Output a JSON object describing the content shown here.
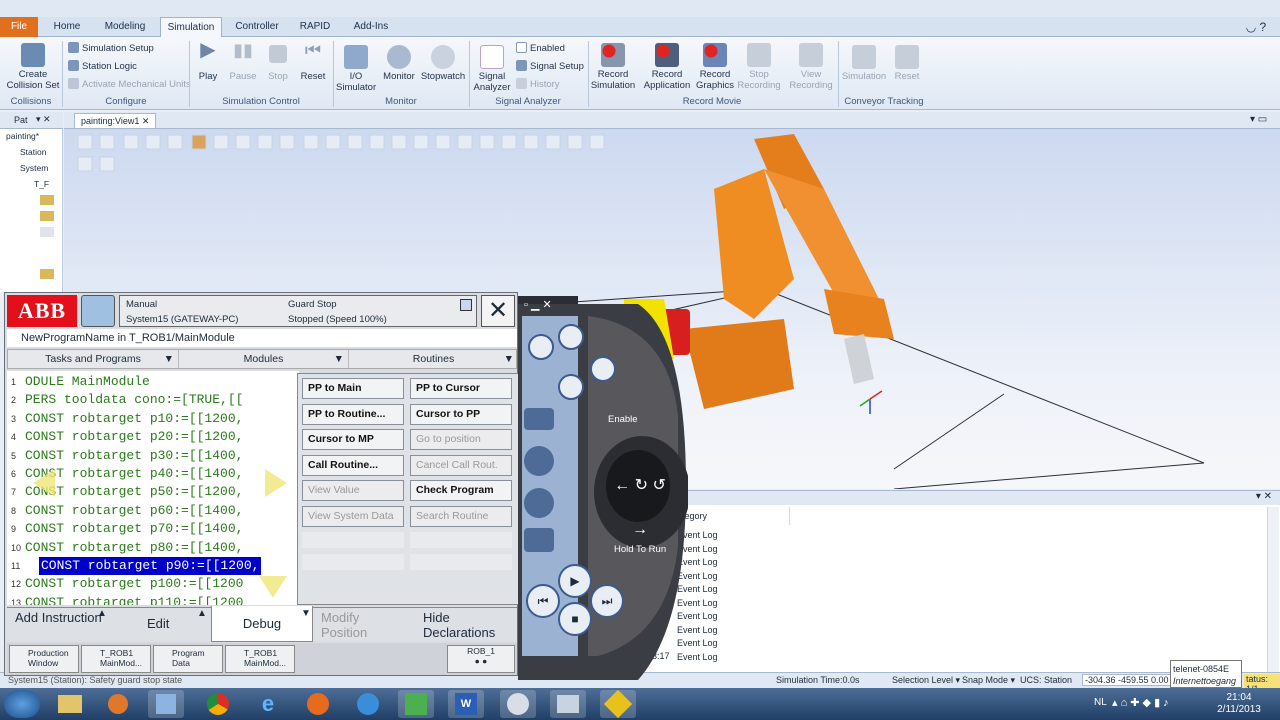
{
  "ribbon": {
    "tabs": [
      "File",
      "Home",
      "Modeling",
      "Simulation",
      "Controller",
      "RAPID",
      "Add-Ins"
    ],
    "collisions": {
      "create": "Create Collision Set",
      "group": "Collisions"
    },
    "configure": {
      "items": [
        "Simulation Setup",
        "Station Logic",
        "Activate Mechanical Units"
      ],
      "group": "Configure"
    },
    "control": {
      "play": "Play",
      "pause": "Pause",
      "stop": "Stop",
      "reset": "Reset",
      "group": "Simulation Control"
    },
    "monitor": {
      "io": "I/O Simulator",
      "monitor": "Monitor",
      "stopwatch": "Stopwatch",
      "group": "Monitor"
    },
    "signal": {
      "analyzer": "Signal Analyzer",
      "enabled": "Enabled",
      "setup": "Signal Setup",
      "history": "History",
      "group": "Signal Analyzer"
    },
    "record": {
      "sim": "Record Simulation",
      "app": "Record Application",
      "graphics": "Record Graphics",
      "stop": "Stop Recording",
      "view": "View Recording",
      "group": "Record Movie"
    },
    "conveyor": {
      "sim": "Simulation",
      "reset": "Reset",
      "group": "Conveyor Tracking"
    }
  },
  "browser": {
    "tab": "Pat",
    "items": [
      "painting*",
      "Station",
      "System",
      "T_F"
    ]
  },
  "view": {
    "tab": "painting:View1"
  },
  "flexpendant": {
    "mode": "Manual",
    "system": "System15 (GATEWAY-PC)",
    "state": "Guard Stop",
    "speed": "Stopped (Speed 100%)",
    "path": "NewProgramName  in  T_ROB1/MainModule",
    "menu": [
      "Tasks and Programs",
      "Modules",
      "Routines"
    ],
    "code": [
      {
        "n": "1",
        "t": "ODULE MainModule"
      },
      {
        "n": "2",
        "t": " PERS tooldata cono:=[TRUE,[["
      },
      {
        "n": "3",
        "t": " CONST robtarget p10:=[[1200,"
      },
      {
        "n": "4",
        "t": " CONST robtarget p20:=[[1200,"
      },
      {
        "n": "5",
        "t": " CONST robtarget p30:=[[1400,"
      },
      {
        "n": "6",
        "t": " CONST robtarget p40:=[[1400,"
      },
      {
        "n": "7",
        "t": " CONST robtarget p50:=[[1200,"
      },
      {
        "n": "8",
        "t": " CONST robtarget p60:=[[1400,"
      },
      {
        "n": "9",
        "t": " CONST robtarget p70:=[[1400,"
      },
      {
        "n": "10",
        "t": " CONST robtarget p80:=[[1400,"
      },
      {
        "n": "11",
        "t": "CONST robtarget p90:=[[1200,"
      },
      {
        "n": "12",
        "t": " CONST robtarget p100:=[[1200"
      },
      {
        "n": "13",
        "t": " CONST robtarget p110:=[[1200"
      }
    ],
    "actions": [
      [
        "PP to Main",
        "PP to Cursor"
      ],
      [
        "PP to Routine...",
        "Cursor to PP"
      ],
      [
        "Cursor to MP",
        "Go to position"
      ],
      [
        "Call Routine...",
        "Cancel Call Rout."
      ],
      [
        "View Value",
        "Check Program"
      ],
      [
        "View System Data",
        "Search Routine"
      ]
    ],
    "bottom": [
      "Add Instruction",
      "Edit",
      "Debug",
      "Modify Position",
      "Hide Declarations"
    ],
    "taskbar": [
      "Production Window",
      "T_ROB1 MainMod...",
      "Program Data",
      "T_ROB1 MainMod..."
    ],
    "rob": "ROB_1"
  },
  "pendant": {
    "enable": "Enable",
    "hold": "Hold To Run"
  },
  "output": {
    "header": "ategory",
    "time": "03:17",
    "rows": [
      "Event Log",
      "Event Log",
      "Event Log",
      "Event Log",
      "Event Log",
      "Event Log",
      "Event Log",
      "Event Log",
      "Event Log",
      "Event Log"
    ]
  },
  "status": {
    "left": "System15 (Station): Safety guard stop state",
    "sim": "Simulation Time:0.0s",
    "selection": "Selection Level ▾",
    "snap": "Snap Mode ▾",
    "ucs": "UCS: Station",
    "coords": "-304.36  -459.55  0.00",
    "tooltip1": "telenet-0854E",
    "tooltip2": "Internettoegang",
    "tatus": "tatus: 1/1"
  },
  "tray": {
    "lang": "NL",
    "time": "21:04",
    "date": "2/11/2013"
  },
  "colors": {
    "abb_red": "#e3101b",
    "robot": "#e8801c",
    "selection": "#0000c8"
  }
}
